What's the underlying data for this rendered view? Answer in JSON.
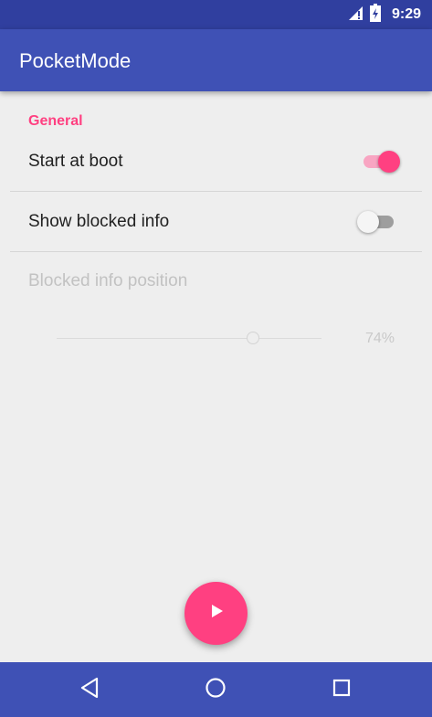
{
  "status_bar": {
    "time": "9:29",
    "icons": [
      "signal-icon",
      "battery-icon"
    ]
  },
  "app_bar": {
    "title": "PocketMode"
  },
  "settings": {
    "section_header": "General",
    "start_at_boot": {
      "label": "Start at boot",
      "enabled": true
    },
    "show_blocked_info": {
      "label": "Show blocked info",
      "enabled": false
    },
    "blocked_info_position": {
      "label": "Blocked info position",
      "value": 74,
      "value_text": "74%",
      "disabled": true
    }
  },
  "fab": {
    "icon": "play-icon"
  },
  "nav_bar": {
    "buttons": [
      "back-icon",
      "home-icon",
      "recents-icon"
    ]
  },
  "colors": {
    "primary": "#3f51b5",
    "primary_dark": "#303f9f",
    "accent": "#ff4081",
    "background": "#eeeeee"
  }
}
